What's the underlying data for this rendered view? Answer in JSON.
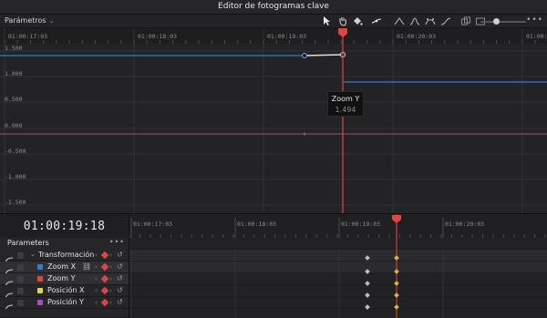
{
  "window": {
    "title": "Editor de fotogramas clave"
  },
  "toolbar": {
    "param_dropdown": "Parámetros",
    "tools": [
      "pointer-icon",
      "hand-icon",
      "fill-icon",
      "draw-curve-icon",
      "ease-linear-icon",
      "ease-in-out-icon",
      "ease-bezier-icon",
      "ease-custom-icon",
      "stack-icon",
      "frame-icon",
      "snap-icon"
    ],
    "more": "•••"
  },
  "graph": {
    "ruler_ticks": [
      "01:00:17:03",
      "01:00:18:03",
      "01:00:19:03",
      "01:00:20:03",
      "01:00:21"
    ],
    "y_labels": [
      "1.500",
      "1.000",
      "0.500",
      "0.000",
      "-0.500",
      "-1.000",
      "-1.500"
    ],
    "colors": {
      "zoom_x": "#2e7fd6",
      "zoom_y": "#e0e0e0",
      "zero_line": "#8c5a6a",
      "playhead": "#e0463f"
    },
    "tooltip": {
      "label": "Zoom Y",
      "value": "1.494"
    }
  },
  "timeline": {
    "timecode": "01:00:19:18",
    "ruler_ticks": [
      "01:00:17:03",
      "01:00:18:03",
      "01:00:19:03",
      "01:00:20:03"
    ]
  },
  "params": {
    "header": "Parameters",
    "more": "•••",
    "group": {
      "label": "Transformación"
    },
    "rows": [
      {
        "label": "Zoom X",
        "color": "#2e7fd6",
        "linked": true
      },
      {
        "label": "Zoom Y",
        "color": "#e0463f"
      },
      {
        "label": "Posición X",
        "color": "#d8d84a"
      },
      {
        "label": "Posición Y",
        "color": "#b04ac8"
      }
    ]
  }
}
